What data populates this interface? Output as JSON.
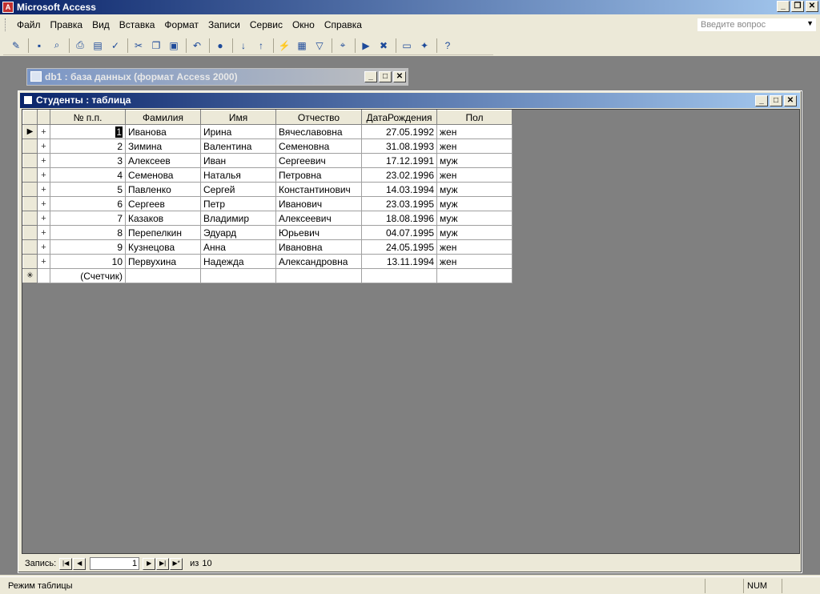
{
  "app": {
    "title": "Microsoft Access"
  },
  "menu": [
    "Файл",
    "Правка",
    "Вид",
    "Вставка",
    "Формат",
    "Записи",
    "Сервис",
    "Окно",
    "Справка"
  ],
  "ask_box": {
    "placeholder": "Введите вопрос"
  },
  "db_window": {
    "title": "db1 : база данных (формат Access 2000)"
  },
  "table_window": {
    "title": "Студенты : таблица",
    "columns": [
      "№ п.п.",
      "Фамилия",
      "Имя",
      "Отчество",
      "ДатаРождения",
      "Пол"
    ],
    "rows": [
      [
        "1",
        "Иванова",
        "Ирина",
        "Вячеславовна",
        "27.05.1992",
        "жен"
      ],
      [
        "2",
        "Зимина",
        "Валентина",
        "Семеновна",
        "31.08.1993",
        "жен"
      ],
      [
        "3",
        "Алексеев",
        "Иван",
        "Сергеевич",
        "17.12.1991",
        "муж"
      ],
      [
        "4",
        "Семенова",
        "Наталья",
        "Петровна",
        "23.02.1996",
        "жен"
      ],
      [
        "5",
        "Павленко",
        "Сергей",
        "Константинович",
        "14.03.1994",
        "муж"
      ],
      [
        "6",
        "Сергеев",
        "Петр",
        "Иванович",
        "23.03.1995",
        "муж"
      ],
      [
        "7",
        "Казаков",
        "Владимир",
        "Алексеевич",
        "18.08.1996",
        "муж"
      ],
      [
        "8",
        "Перепелкин",
        "Эдуард",
        "Юрьевич",
        "04.07.1995",
        "муж"
      ],
      [
        "9",
        "Кузнецова",
        "Анна",
        "Ивановна",
        "24.05.1995",
        "жен"
      ],
      [
        "10",
        "Первухина",
        "Надежда",
        "Александровна",
        "13.11.1994",
        "жен"
      ]
    ],
    "new_row_placeholder": "(Счетчик)"
  },
  "navigator": {
    "label": "Запись:",
    "current": "1",
    "of_label": "из",
    "total": "10"
  },
  "status": {
    "text": "Режим таблицы",
    "num": "NUM"
  }
}
